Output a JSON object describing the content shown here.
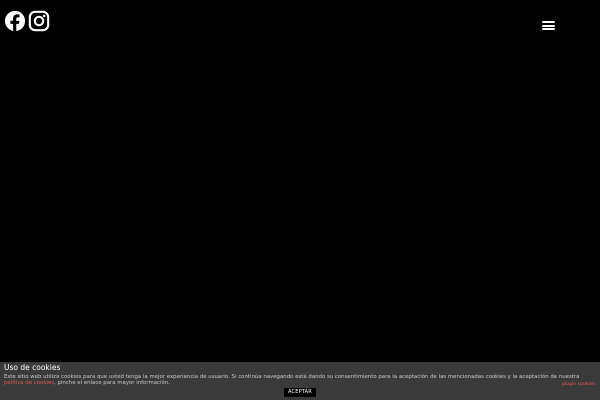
{
  "header": {
    "social": {
      "facebook_icon": "facebook-icon",
      "instagram_icon": "instagram-icon"
    },
    "menu_icon": "hamburger-menu-icon"
  },
  "cookie_notice": {
    "title": "Uso de cookies",
    "text_before_link": "Este sitio web utiliza cookies para que usted tenga la mejor experiencia de usuario. Si continúa navegando está dando su consentimiento para la aceptación de las mencionadas cookies y la aceptación de nuestra ",
    "policy_link": "política de cookies",
    "text_after_link": ", pinche el enlace para mayor información.",
    "plugin_link": "plugin cookies",
    "accept_label": "ACEPTAR"
  },
  "colors": {
    "background": "#000000",
    "cookie_bar": "#3a3a3a",
    "link": "#e0595c",
    "text": "#c8c8c8"
  }
}
